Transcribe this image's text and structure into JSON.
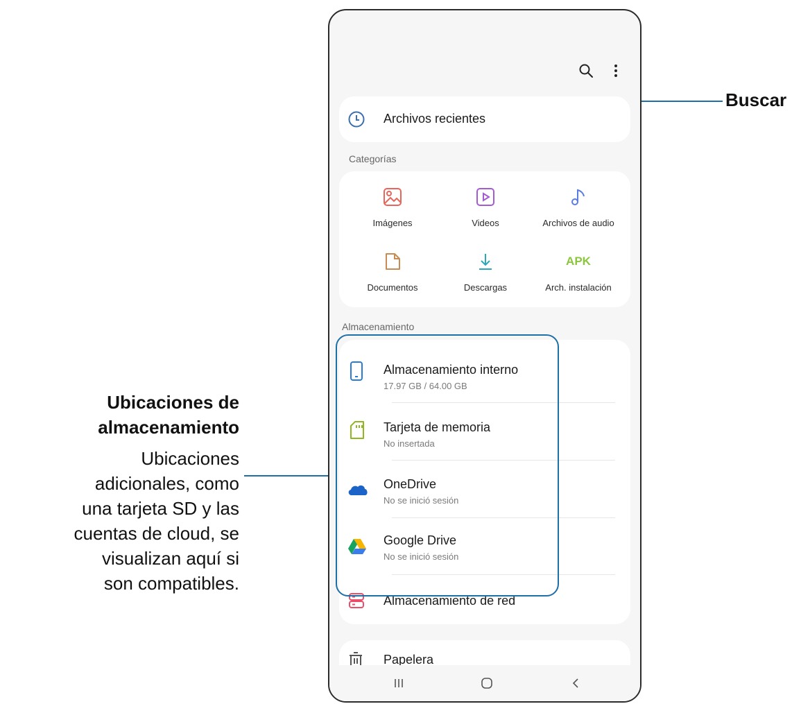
{
  "header": {
    "search_icon": "search-icon",
    "more_icon": "more-vertical-icon"
  },
  "recent": {
    "label": "Archivos recientes"
  },
  "categories": {
    "label": "Categorías",
    "items": [
      {
        "label": "Imágenes",
        "icon": "image-icon",
        "color": "#e8655a"
      },
      {
        "label": "Videos",
        "icon": "video-icon",
        "color": "#a35bd1"
      },
      {
        "label": "Archivos de audio",
        "icon": "audio-icon",
        "color": "#5b7de0"
      },
      {
        "label": "Documentos",
        "icon": "document-icon",
        "color": "#c98b52"
      },
      {
        "label": "Descargas",
        "icon": "download-icon",
        "color": "#2aa7b8"
      },
      {
        "label": "Arch. instalación",
        "icon": "apk-icon",
        "color": "#8cc63f",
        "icon_text": "APK"
      }
    ]
  },
  "storage": {
    "label": "Almacenamiento",
    "items": [
      {
        "title": "Almacenamiento interno",
        "subtitle": "17.97 GB / 64.00 GB",
        "icon": "phone-icon",
        "color": "#2a7bd6"
      },
      {
        "title": "Tarjeta de memoria",
        "subtitle": "No insertada",
        "icon": "sd-card-icon",
        "color": "#8fb81f"
      },
      {
        "title": "OneDrive",
        "subtitle": "No se inició sesión",
        "icon": "onedrive-icon",
        "color": "#1b63c6"
      },
      {
        "title": "Google Drive",
        "subtitle": "No se inició sesión",
        "icon": "google-drive-icon"
      },
      {
        "title": "Almacenamiento de red",
        "subtitle": "",
        "icon": "network-storage-icon",
        "color": "#e94e6a"
      }
    ]
  },
  "trash": {
    "label": "Papelera"
  },
  "callouts": {
    "search": {
      "title": "Buscar"
    },
    "storage": {
      "title_line1": "Ubicaciones de",
      "title_line2": "almacenamiento",
      "desc": [
        "Ubicaciones",
        "adicionales, como",
        "una tarjeta SD y las",
        "cuentas de cloud, se",
        "visualizan aquí si",
        "son compatibles."
      ]
    }
  },
  "colors": {
    "accent": "#1e6fa8"
  }
}
